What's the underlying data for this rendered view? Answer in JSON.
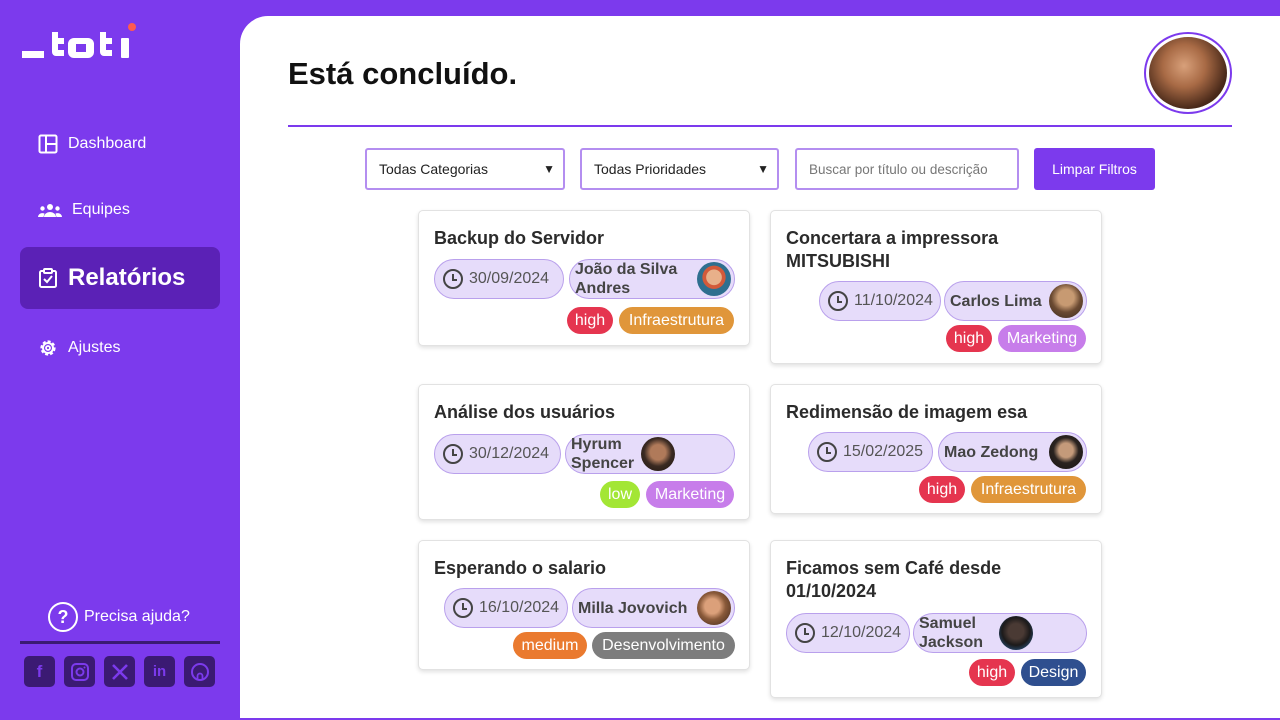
{
  "brand": {
    "logo_text": "_toti"
  },
  "nav": [
    {
      "label": "Dashboard",
      "icon": "dashboard-icon"
    },
    {
      "label": "Equipes",
      "icon": "team-icon"
    },
    {
      "label": "Relatórios",
      "icon": "clipboard-check-icon",
      "active": true
    },
    {
      "label": "Ajustes",
      "icon": "gear-icon"
    }
  ],
  "help": {
    "label": "Precisa ajuda?"
  },
  "socials": [
    "facebook-icon",
    "instagram-icon",
    "x-icon",
    "linkedin-icon",
    "github-icon"
  ],
  "page": {
    "title": "Está concluído."
  },
  "filters": {
    "category": "Todas Categorias",
    "priority": "Todas Prioridades",
    "search_placeholder": "Buscar por título ou descrição",
    "clear_label": "Limpar Filtros"
  },
  "colors": {
    "accent": "#7c3aed",
    "high": "#e5354f",
    "low": "#a3e635",
    "medium": "#ea7a2f",
    "Infraestrutura": "#e0963a",
    "Marketing": "#c77dea",
    "Desenvolvimento": "#7d7d7d",
    "Design": "#2f4f8f"
  },
  "cards": [
    {
      "title": "Backup do Servidor",
      "date": "30/09/2024",
      "user": "João da Silva Andres",
      "priority": "high",
      "category": "Infraestrutura"
    },
    {
      "title": "Concertara a impressora MITSUBISHI",
      "date": "11/10/2024",
      "user": "Carlos Lima",
      "priority": "high",
      "category": "Marketing"
    },
    {
      "title": "Análise dos usuários",
      "date": "30/12/2024",
      "user": "Hyrum Spencer",
      "priority": "low",
      "category": "Marketing"
    },
    {
      "title": "Redimensão de imagem esa",
      "date": "15/02/2025",
      "user": "Mao Zedong",
      "priority": "high",
      "category": "Infraestrutura"
    },
    {
      "title": "Esperando o salario",
      "date": "16/10/2024",
      "user": "Milla Jovovich",
      "priority": "medium",
      "category": "Desenvolvimento"
    },
    {
      "title": "Ficamos sem Café desde 01/10/2024",
      "date": "12/10/2024",
      "user": "Samuel Jackson",
      "priority": "high",
      "category": "Design"
    }
  ]
}
